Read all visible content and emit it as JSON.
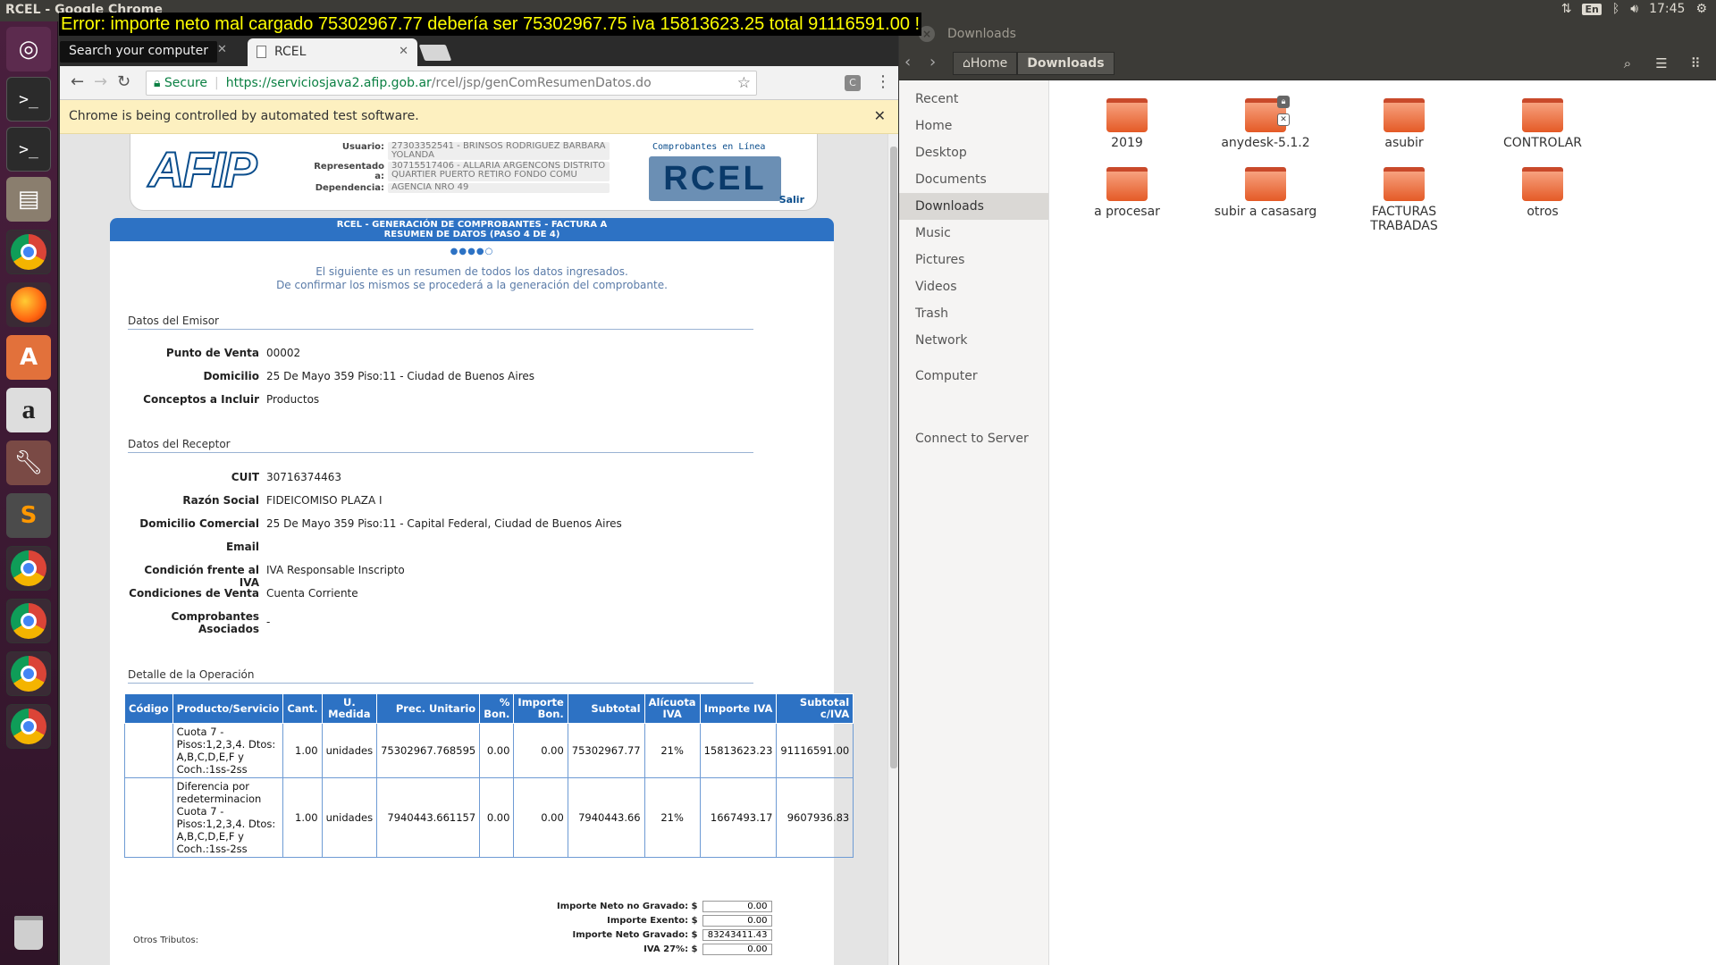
{
  "top_panel": {
    "window_title": "RCEL - Google Chrome",
    "lang": "En",
    "clock": "17:45"
  },
  "error_overlay": "Error: importe neto mal cargado 75302967.77 debería ser 75302967.75 iva 15813623.25 total 91116591.00 !",
  "nautilus": {
    "title": "Downloads",
    "crumbs": [
      "Home",
      "Downloads"
    ],
    "sidebar": [
      "Recent",
      "Home",
      "Desktop",
      "Documents",
      "Downloads",
      "Music",
      "Pictures",
      "Videos",
      "Trash",
      "Network",
      "Computer",
      "Connect to Server"
    ],
    "folders": [
      "2019",
      "anydesk-5.1.2",
      "asubir",
      "CONTROLAR",
      "a procesar",
      "subir a casasarg",
      "FACTURAS TRABADAS",
      "otros"
    ]
  },
  "chrome": {
    "search_tooltip": "Search your computer",
    "tab_title": "RCEL",
    "secure_label": "Secure",
    "url_scheme": "https://",
    "url_host": "serviciosjava2.afip.gob.ar",
    "url_path": "/rcel/jsp/genComResumenDatos.do",
    "infobar": "Chrome is being controlled by automated test software."
  },
  "afip": {
    "logo": "AFIP",
    "usuario_label": "Usuario:",
    "usuario": "27303352541 - BRINSOS RODRIGUEZ BARBARA YOLANDA",
    "representado_label": "Representado a:",
    "representado": "30715517406 - ALLARIA ARGENCONS DISTRITO QUARTIER PUERTO RETIRO FONDO COMU",
    "dependencia_label": "Dependencia:",
    "dependencia": "AGENCIA NRO 49",
    "rcel_tag": "Comprobantes en Línea",
    "rcel_logo": "RCEL",
    "salir": "Salir"
  },
  "form": {
    "band_line1": "RCEL - GENERACIÓN DE COMPROBANTES - FACTURA A",
    "band_line2": "RESUMEN DE DATOS (PASO 4 DE 4)",
    "progress": "●●●●○",
    "intro_line1": "El siguiente es un resumen de todos los datos ingresados.",
    "intro_line2": "De confirmar los mismos se procederá a la generación del comprobante.",
    "emisor_title": "Datos del Emisor",
    "emisor": [
      {
        "label": "Punto de Venta",
        "value": "00002"
      },
      {
        "label": "Domicilio",
        "value": "25 De Mayo 359 Piso:11 - Ciudad de Buenos Aires"
      },
      {
        "label": "Conceptos a Incluir",
        "value": "Productos"
      }
    ],
    "receptor_title": "Datos del Receptor",
    "receptor": [
      {
        "label": "CUIT",
        "value": "30716374463"
      },
      {
        "label": "Razón Social",
        "value": "FIDEICOMISO PLAZA I"
      },
      {
        "label": "Domicilio Comercial",
        "value": "25 De Mayo 359 Piso:11 - Capital Federal, Ciudad de Buenos Aires"
      },
      {
        "label": "Email",
        "value": ""
      },
      {
        "label": "Condición frente al IVA",
        "value": "IVA Responsable Inscripto"
      },
      {
        "label": "Condiciones de Venta",
        "value": "Cuenta Corriente"
      },
      {
        "label": "Comprobantes Asociados",
        "value": "-"
      }
    ],
    "detalle_title": "Detalle de la Operación",
    "table_headers": [
      "Código",
      "Producto/Servicio",
      "Cant.",
      "U. Medida",
      "Prec. Unitario",
      "% Bon.",
      "Importe Bon.",
      "Subtotal",
      "Alícuota IVA",
      "Importe IVA",
      "Subtotal c/IVA"
    ],
    "table_rows": [
      [
        "",
        "Cuota 7 - Pisos:1,2,3,4. Dtos: A,B,C,D,E,F y Coch.:1ss-2ss",
        "1.00",
        "unidades",
        "75302967.768595",
        "0.00",
        "0.00",
        "75302967.77",
        "21%",
        "15813623.23",
        "91116591.00"
      ],
      [
        "",
        "Diferencia por redeterminacion Cuota 7 - Pisos:1,2,3,4. Dtos: A,B,C,D,E,F y Coch.:1ss-2ss",
        "1.00",
        "unidades",
        "7940443.661157",
        "0.00",
        "0.00",
        "7940443.66",
        "21%",
        "1667493.17",
        "9607936.83"
      ]
    ],
    "totals": [
      {
        "label": "Importe Neto no Gravado: $",
        "value": "0.00"
      },
      {
        "label": "Importe Exento: $",
        "value": "0.00"
      },
      {
        "label": "Importe Neto Gravado: $",
        "value": "83243411.43"
      },
      {
        "label": "IVA 27%: $",
        "value": "0.00"
      }
    ],
    "otros_tributos": "Otros Tributos:"
  }
}
